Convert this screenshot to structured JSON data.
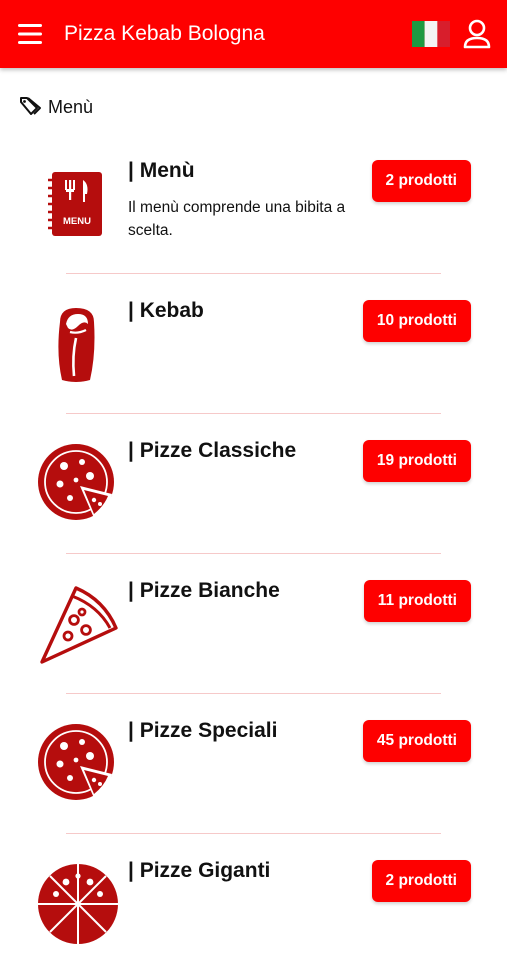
{
  "header": {
    "title": "Pizza Kebab Bologna",
    "menu_icon": "hamburger-menu-icon",
    "flag_icon": "italian-flag-icon",
    "user_icon": "user-account-icon"
  },
  "breadcrumb": {
    "icon": "tag-icon",
    "label": "Menù"
  },
  "colors": {
    "primary_red": "#fe0000",
    "icon_dark_red": "#b50d0d",
    "divider": "#f6c9c9"
  },
  "categories": [
    {
      "title": "| Menù",
      "description": "Il menù comprende una bibita a scelta.",
      "badge": "2 prodotti",
      "icon": "menu-book-icon",
      "icon_label": "MENU"
    },
    {
      "title": "| Kebab",
      "description": "",
      "badge": "10 prodotti",
      "icon": "kebab-icon"
    },
    {
      "title": "| Pizze Classiche",
      "description": "",
      "badge": "19 prodotti",
      "icon": "pizza-icon"
    },
    {
      "title": "| Pizze Bianche",
      "description": "",
      "badge": "11 prodotti",
      "icon": "pizza-slice-icon"
    },
    {
      "title": "| Pizze Speciali",
      "description": "",
      "badge": "45 prodotti",
      "icon": "pizza-icon"
    },
    {
      "title": "| Pizze Giganti",
      "description": "",
      "badge": "2 prodotti",
      "icon": "large-pizza-icon"
    }
  ]
}
